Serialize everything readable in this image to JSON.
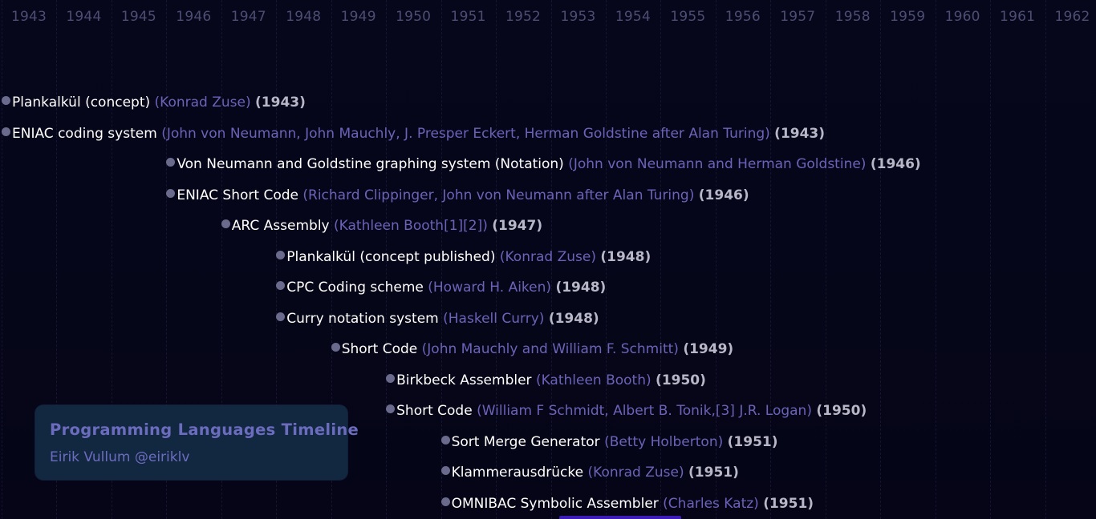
{
  "years": [
    "1943",
    "1944",
    "1945",
    "1946",
    "1947",
    "1948",
    "1949",
    "1950",
    "1951",
    "1952",
    "1953",
    "1954",
    "1955",
    "1956",
    "1957",
    "1958",
    "1959",
    "1960",
    "1961",
    "1962"
  ],
  "entries": [
    {
      "name": "Plankalkül (concept)",
      "authors": "(Konrad Zuse)",
      "year": "(1943)",
      "start_year": 1943
    },
    {
      "name": "ENIAC coding system",
      "authors": "(John von Neumann, John Mauchly, J. Presper Eckert, Herman Goldstine after Alan Turing)",
      "year": "(1943)",
      "start_year": 1943
    },
    {
      "name": "Von Neumann and Goldstine graphing system (Notation)",
      "authors": "(John von Neumann and Herman Goldstine)",
      "year": "(1946)",
      "start_year": 1946
    },
    {
      "name": "ENIAC Short Code",
      "authors": "(Richard Clippinger, John von Neumann after Alan Turing)",
      "year": "(1946)",
      "start_year": 1946
    },
    {
      "name": "ARC Assembly",
      "authors": "(Kathleen Booth[1][2])",
      "year": "(1947)",
      "start_year": 1947
    },
    {
      "name": "Plankalkül (concept published)",
      "authors": "(Konrad Zuse)",
      "year": "(1948)",
      "start_year": 1948
    },
    {
      "name": "CPC Coding scheme",
      "authors": "(Howard H. Aiken)",
      "year": "(1948)",
      "start_year": 1948
    },
    {
      "name": "Curry notation system",
      "authors": "(Haskell Curry)",
      "year": "(1948)",
      "start_year": 1948
    },
    {
      "name": "Short Code",
      "authors": "(John Mauchly and William F. Schmitt)",
      "year": "(1949)",
      "start_year": 1949
    },
    {
      "name": "Birkbeck Assembler",
      "authors": "(Kathleen Booth)",
      "year": "(1950)",
      "start_year": 1950
    },
    {
      "name": "Short Code",
      "authors": "(William F Schmidt, Albert B. Tonik,[3] J.R. Logan)",
      "year": "(1950)",
      "start_year": 1950
    },
    {
      "name": "Sort Merge Generator",
      "authors": "(Betty Holberton)",
      "year": "(1951)",
      "start_year": 1951
    },
    {
      "name": "Klammerausdrücke",
      "authors": "(Konrad Zuse)",
      "year": "(1951)",
      "start_year": 1951
    },
    {
      "name": "OMNIBAC Symbolic Assembler",
      "authors": "(Charles Katz)",
      "year": "(1951)",
      "start_year": 1951
    }
  ],
  "card": {
    "title": "Programming Languages Timeline",
    "author": "Eirik Vullum @eiriklv"
  },
  "colors": {
    "background": "#06061a",
    "name": "#ffffff",
    "authors": "#6c63b8",
    "year": "#b7b7c7",
    "axis_label": "#4d4d73",
    "card_bg": "#122740",
    "card_text": "#6c6cbf",
    "scroll_indicator": "#3d1bb8"
  }
}
